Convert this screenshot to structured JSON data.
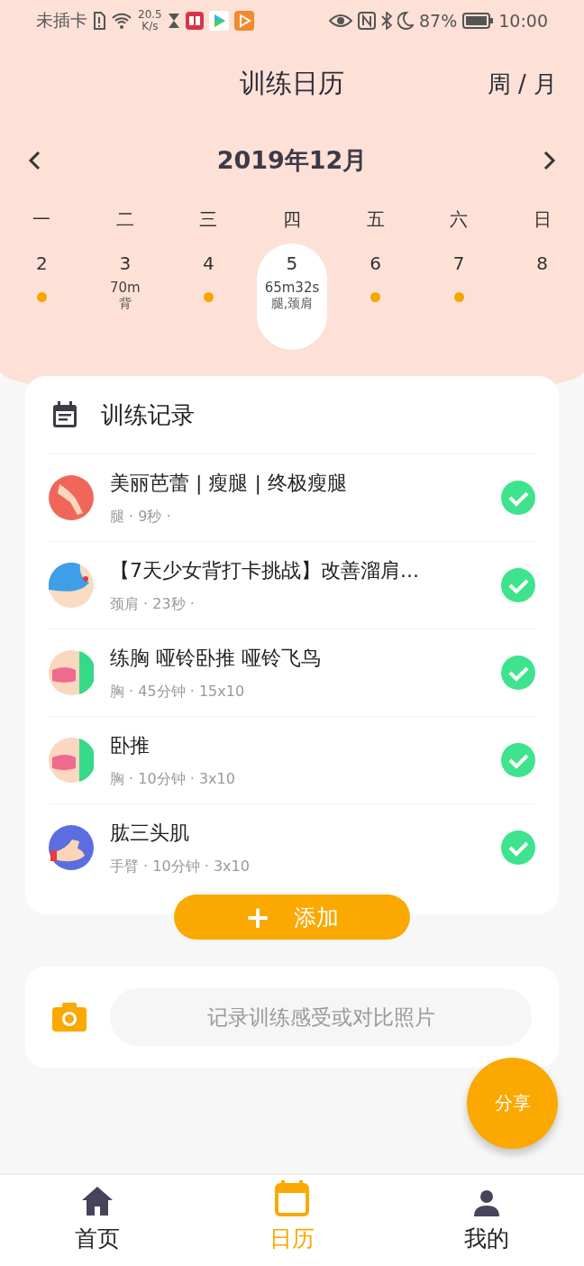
{
  "status_bar": {
    "carrier": "未插卡",
    "speed": "20.5",
    "speed_unit": "K/s",
    "battery": "87%",
    "time": "10:00"
  },
  "header": {
    "title": "训练日历",
    "toggle": "周 / 月"
  },
  "calendar": {
    "month": "2019年12月",
    "weekdays": [
      "一",
      "二",
      "三",
      "四",
      "五",
      "六",
      "日"
    ],
    "days": [
      {
        "day": "2",
        "dot": true,
        "selected": false
      },
      {
        "day": "3",
        "duration": "70m",
        "part": "背",
        "dot": false,
        "selected": false
      },
      {
        "day": "4",
        "dot": true,
        "selected": false
      },
      {
        "day": "5",
        "duration": "65m32s",
        "part": "腿,颈肩",
        "dot": false,
        "selected": true
      },
      {
        "day": "6",
        "dot": true,
        "selected": false
      },
      {
        "day": "7",
        "dot": true,
        "selected": false
      },
      {
        "day": "8",
        "dot": false,
        "selected": false
      }
    ]
  },
  "records": {
    "title": "训练记录",
    "items": [
      {
        "kind": "legs",
        "title": "美丽芭蕾 | 瘦腿 | 终极瘦腿",
        "meta": "腿 · 9秒 ·",
        "done": true
      },
      {
        "kind": "shoulder",
        "title": "【7天少女背打卡挑战】改善溜肩...",
        "meta": "颈肩 · 23秒 ·",
        "done": true
      },
      {
        "kind": "chest",
        "title": "练胸 哑铃卧推 哑铃飞鸟",
        "meta": "胸 · 45分钟 · 15x10",
        "done": true
      },
      {
        "kind": "chest",
        "title": "卧推",
        "meta": "胸 · 10分钟 · 3x10",
        "done": true
      },
      {
        "kind": "arm",
        "title": "肱三头肌",
        "meta": "手臂 · 10分钟 · 3x10",
        "done": true
      }
    ],
    "add_button": {
      "icon": "+",
      "label": "添加"
    }
  },
  "note": {
    "placeholder": "记录训练感受或对比照片"
  },
  "share_button": "分享",
  "tabs": [
    {
      "kind": "home",
      "label": "首页",
      "selected": false
    },
    {
      "kind": "calendar",
      "label": "日历",
      "selected": true
    },
    {
      "kind": "profile",
      "label": "我的",
      "selected": false
    }
  ]
}
